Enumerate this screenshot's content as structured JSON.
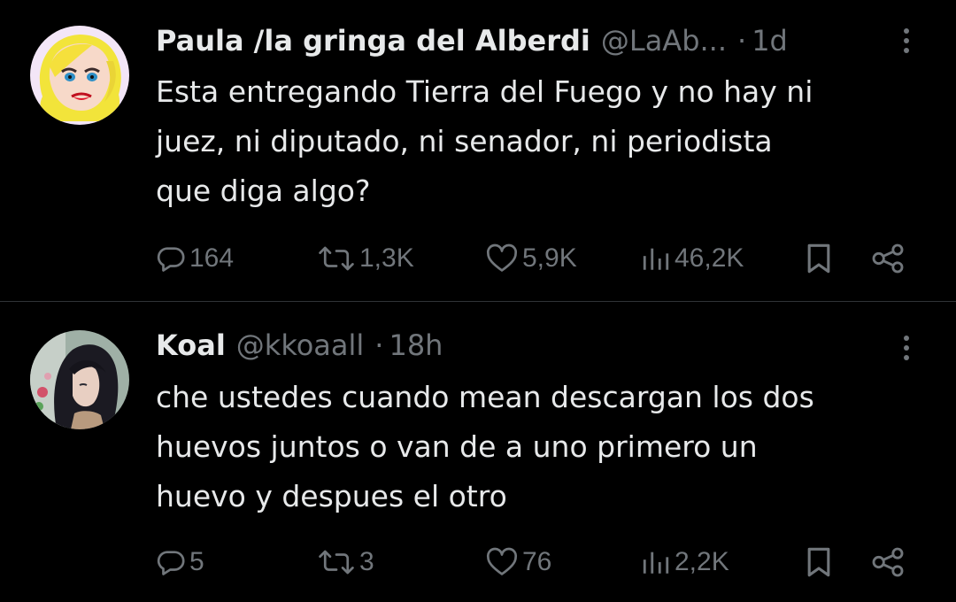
{
  "tweets": [
    {
      "display_name": "Paula /la gringa del Alberdi",
      "handle": "@LaAb...",
      "separator": "·",
      "time": "1d",
      "text_lines": [
        "Esta entregando Tierra del Fuego y no hay ni",
        "juez, ni diputado, ni senador, ni periodista",
        "que diga algo?"
      ],
      "replies": "164",
      "reposts": "1,3K",
      "likes": "5,9K",
      "views": "46,2K",
      "avatar_icon": "blonde-woman-cartoon-avatar"
    },
    {
      "display_name": "Koal",
      "handle": "@kkoaall",
      "separator": "·",
      "time": "18h",
      "text_lines": [
        "che ustedes cuando mean descargan los dos",
        "huevos juntos o van de a uno primero un",
        "huevo y despues el otro"
      ],
      "replies": "5",
      "reposts": "3",
      "likes": "76",
      "views": "2,2K",
      "avatar_icon": "anime-girl-avatar"
    }
  ],
  "icons": {
    "reply": "reply-bubble-icon",
    "repost": "repost-arrows-icon",
    "like": "heart-icon",
    "views": "bar-chart-icon",
    "bookmark": "bookmark-icon",
    "share": "share-nodes-icon",
    "more": "more-vertical-icon"
  },
  "colors": {
    "background": "#000000",
    "text_primary": "#e7e9ea",
    "text_secondary": "#71767b",
    "divider": "#2f3336"
  }
}
